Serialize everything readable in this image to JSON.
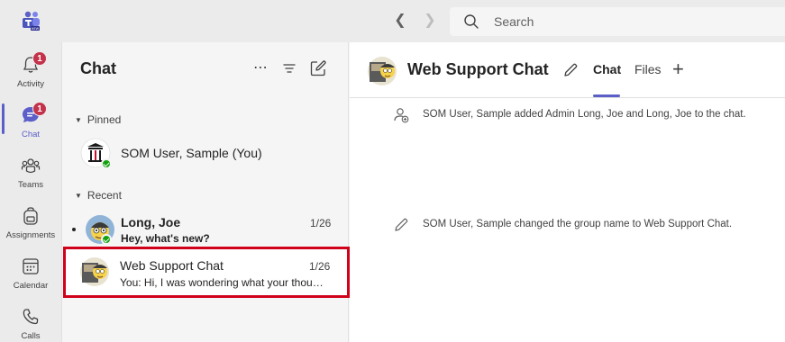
{
  "search": {
    "placeholder": "Search"
  },
  "rail": {
    "items": [
      {
        "label": "Activity",
        "badge": "1"
      },
      {
        "label": "Chat",
        "badge": "1"
      },
      {
        "label": "Teams"
      },
      {
        "label": "Assignments"
      },
      {
        "label": "Calendar"
      },
      {
        "label": "Calls"
      }
    ]
  },
  "chat_list": {
    "title": "Chat",
    "sections": {
      "pinned": "Pinned",
      "recent": "Recent"
    },
    "pinned": [
      {
        "name": "SOM User, Sample (You)"
      }
    ],
    "recent": [
      {
        "name": "Long, Joe",
        "date": "1/26",
        "preview": "Hey, what's new?"
      },
      {
        "name": "Web Support Chat",
        "date": "1/26",
        "preview": "You: Hi, I was wondering what your thoughts..."
      }
    ]
  },
  "main": {
    "title": "Web Support Chat",
    "tabs": [
      "Chat",
      "Files"
    ],
    "messages": [
      "SOM User, Sample added Admin Long, Joe and Long, Joe to the chat.",
      "SOM User, Sample changed the group name to Web Support Chat."
    ]
  },
  "colors": {
    "accent": "#5b5fc7",
    "badge": "#c4314b",
    "highlight_border": "#d0021b",
    "presence": "#13a10e"
  }
}
